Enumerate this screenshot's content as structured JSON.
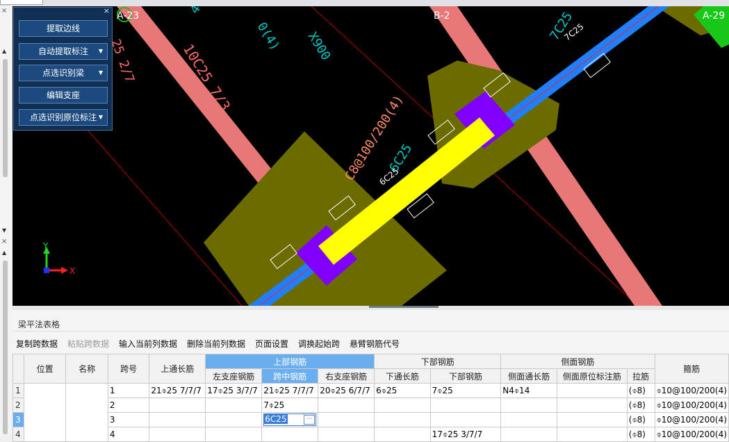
{
  "drawing": {
    "axis_labels": [
      "A-23",
      "B-2",
      "A-29"
    ],
    "rebar_texts": [
      "10C25 7/3",
      "25 2/7",
      "C8@100/200(4)",
      "6C25",
      "6C25",
      "7C25",
      "7C25",
      "4",
      "X900",
      "0(4)"
    ],
    "coord_axes": {
      "y": "Y",
      "x": "X"
    }
  },
  "tool_panel": {
    "buttons": [
      {
        "label": "提取边线",
        "dropdown": false
      },
      {
        "label": "自动提取标注",
        "dropdown": true
      },
      {
        "label": "点选识别梁",
        "dropdown": true
      },
      {
        "label": "编辑支座",
        "dropdown": false
      },
      {
        "label": "点选识别原位标注",
        "dropdown": true
      }
    ]
  },
  "table_panel": {
    "title": "梁平法表格",
    "toolbar": [
      {
        "label": "复制跨数据",
        "enabled": true
      },
      {
        "label": "粘贴跨数据",
        "enabled": false
      },
      {
        "label": "输入当前列数据",
        "enabled": true
      },
      {
        "label": "删除当前列数据",
        "enabled": true
      },
      {
        "label": "页面设置",
        "enabled": true
      },
      {
        "label": "调换起始跨",
        "enabled": true
      },
      {
        "label": "悬臂钢筋代号",
        "enabled": true
      }
    ],
    "headers": {
      "position": "位置",
      "name": "名称",
      "span_no": "跨号",
      "top_through": "上通长筋",
      "top_group": "上部钢筋",
      "left_support": "左支座钢筋",
      "mid_span": "跨中钢筋",
      "right_support": "右支座钢筋",
      "bottom_group": "下部钢筋",
      "bottom_through": "下通长筋",
      "bottom_bars": "下部钢筋",
      "side_group": "侧面钢筋",
      "side_through": "侧面通长筋",
      "side_original": "侧面原位标注筋",
      "tie": "拉筋",
      "stirrup": "箍筋"
    },
    "rows": [
      {
        "row_no": "1",
        "position": "",
        "name": "",
        "span": "1",
        "top_through": "21⌽25 7/7/7",
        "left_support": "17⌽25 3/7/7",
        "mid_span": "21⌽25 7/7/7",
        "right_support": "20⌽25 6/7/7",
        "bottom_through": "6⌽25",
        "bottom_bars": "7⌽25",
        "side_through": "N4⌽14",
        "side_original": "",
        "tie": "(⌽8)",
        "stirrup": "⌽10@100/200(4)"
      },
      {
        "row_no": "2",
        "position": "",
        "name": "",
        "span": "2",
        "top_through": "",
        "left_support": "",
        "mid_span": "7⌽25",
        "right_support": "",
        "bottom_through": "",
        "bottom_bars": "",
        "side_through": "",
        "side_original": "",
        "tie": "(⌽8)",
        "stirrup": "⌽10@100/200(4)"
      },
      {
        "row_no": "3",
        "position": "",
        "name": "",
        "span": "3",
        "top_through": "",
        "left_support": "",
        "mid_span": "6C25",
        "right_support": "",
        "bottom_through": "",
        "bottom_bars": "",
        "side_through": "",
        "side_original": "",
        "tie": "(⌽8)",
        "stirrup": "⌽10@100/200(4)"
      },
      {
        "row_no": "4",
        "position": "",
        "name": "",
        "span": "4",
        "top_through": "",
        "left_support": "",
        "mid_span": "",
        "right_support": "",
        "bottom_through": "",
        "bottom_bars": "17⌽25 3/7/7",
        "side_through": "",
        "side_original": "",
        "tie": "(⌽8)",
        "stirrup": "⌽10@100/200(4)"
      }
    ],
    "editing_cell": {
      "row": 3,
      "value": "6C25"
    }
  },
  "colors": {
    "canvas_bg": "#000000",
    "beam_blue": "#1f7fff",
    "beam_pink": "#e87878",
    "selected_beam": "#ffff00",
    "support_olive": "#6b6b00",
    "support_purple": "#8000ff",
    "panel_navy": "#0f2f55",
    "header_blue": "#6baef0"
  }
}
